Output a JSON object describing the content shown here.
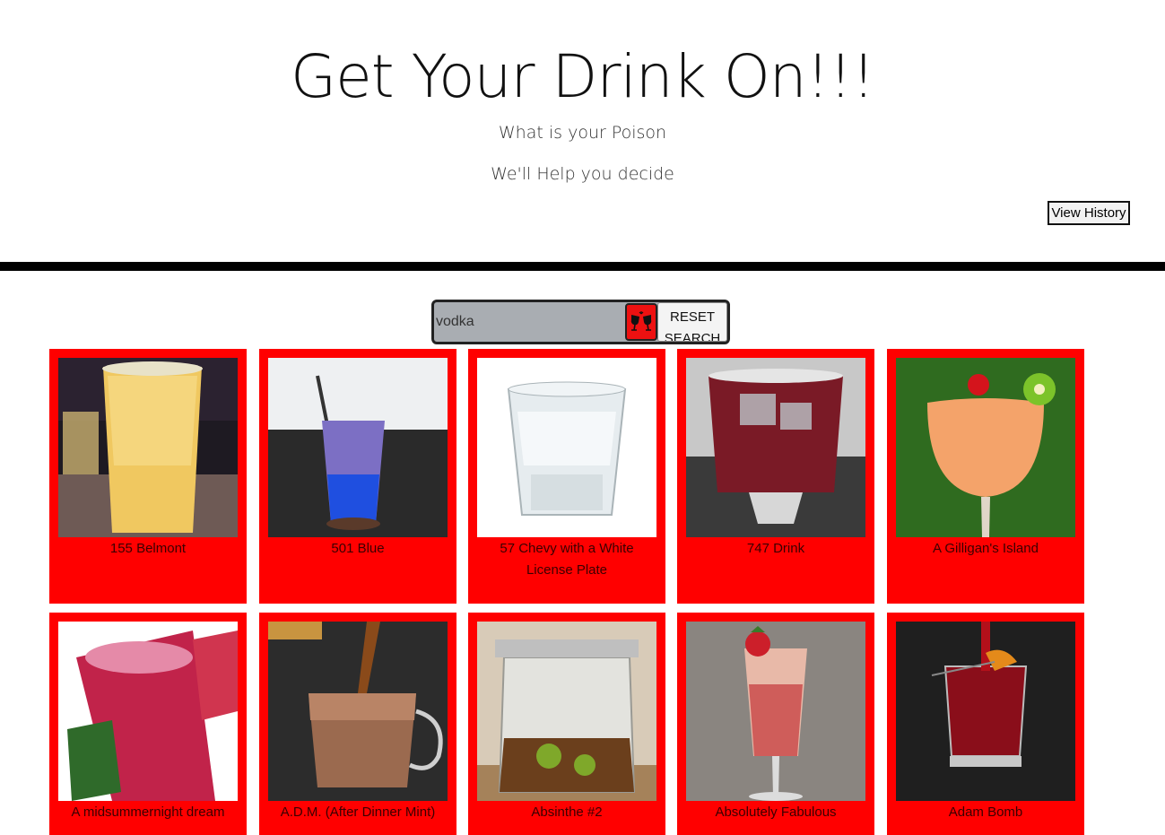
{
  "header": {
    "title": "Get Your Drink On!!!",
    "subtitle": "What is your Poison",
    "tagline": "We'll Help you decide",
    "history_button": "View History"
  },
  "search": {
    "value": "vodka",
    "search_icon": "clinking-glasses-icon",
    "reset_label": "RESET SEARCH"
  },
  "colors": {
    "card_background": "#ff0000",
    "search_bar": "#a9adb2",
    "divider": "#000000"
  },
  "drinks": [
    {
      "name": "155 Belmont"
    },
    {
      "name": "501 Blue"
    },
    {
      "name": "57 Chevy with a White License Plate"
    },
    {
      "name": "747 Drink"
    },
    {
      "name": "A Gilligan's Island"
    },
    {
      "name": "A midsummernight dream"
    },
    {
      "name": "A.D.M. (After Dinner Mint)"
    },
    {
      "name": "Absinthe #2"
    },
    {
      "name": "Absolutely Fabulous"
    },
    {
      "name": "Adam Bomb"
    }
  ]
}
